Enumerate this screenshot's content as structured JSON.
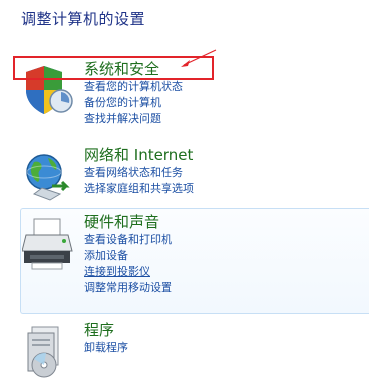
{
  "page": {
    "title": "调整计算机的设置"
  },
  "categories": [
    {
      "title": "系统和安全",
      "icon": "shield-icon",
      "links": [
        "查看您的计算机状态",
        "备份您的计算机",
        "查找并解决问题"
      ]
    },
    {
      "title": "网络和 Internet",
      "icon": "network-globe-icon",
      "links": [
        "查看网络状态和任务",
        "选择家庭组和共享选项"
      ]
    },
    {
      "title": "硬件和声音",
      "icon": "printer-icon",
      "links": [
        "查看设备和打印机",
        "添加设备",
        "连接到投影仪",
        "调整常用移动设置"
      ]
    },
    {
      "title": "程序",
      "icon": "programs-icon",
      "links": [
        "卸载程序"
      ]
    }
  ],
  "colors": {
    "title_blue": "#1e3287",
    "category_green": "#1e6e1e",
    "link_blue": "#1c4fa3",
    "annotation_red": "#e2242a"
  }
}
